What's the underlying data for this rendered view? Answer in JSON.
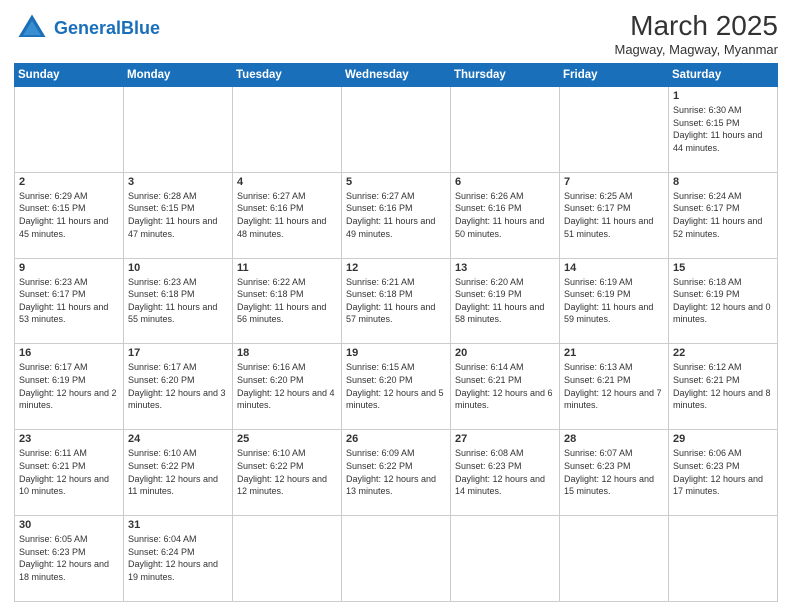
{
  "header": {
    "logo_general": "General",
    "logo_blue": "Blue",
    "month_title": "March 2025",
    "location": "Magway, Magway, Myanmar"
  },
  "weekdays": [
    "Sunday",
    "Monday",
    "Tuesday",
    "Wednesday",
    "Thursday",
    "Friday",
    "Saturday"
  ],
  "weeks": [
    [
      {
        "day": "",
        "info": ""
      },
      {
        "day": "",
        "info": ""
      },
      {
        "day": "",
        "info": ""
      },
      {
        "day": "",
        "info": ""
      },
      {
        "day": "",
        "info": ""
      },
      {
        "day": "",
        "info": ""
      },
      {
        "day": "1",
        "info": "Sunrise: 6:30 AM\nSunset: 6:15 PM\nDaylight: 11 hours and 44 minutes."
      }
    ],
    [
      {
        "day": "2",
        "info": "Sunrise: 6:29 AM\nSunset: 6:15 PM\nDaylight: 11 hours and 45 minutes."
      },
      {
        "day": "3",
        "info": "Sunrise: 6:28 AM\nSunset: 6:15 PM\nDaylight: 11 hours and 47 minutes."
      },
      {
        "day": "4",
        "info": "Sunrise: 6:27 AM\nSunset: 6:16 PM\nDaylight: 11 hours and 48 minutes."
      },
      {
        "day": "5",
        "info": "Sunrise: 6:27 AM\nSunset: 6:16 PM\nDaylight: 11 hours and 49 minutes."
      },
      {
        "day": "6",
        "info": "Sunrise: 6:26 AM\nSunset: 6:16 PM\nDaylight: 11 hours and 50 minutes."
      },
      {
        "day": "7",
        "info": "Sunrise: 6:25 AM\nSunset: 6:17 PM\nDaylight: 11 hours and 51 minutes."
      },
      {
        "day": "8",
        "info": "Sunrise: 6:24 AM\nSunset: 6:17 PM\nDaylight: 11 hours and 52 minutes."
      }
    ],
    [
      {
        "day": "9",
        "info": "Sunrise: 6:23 AM\nSunset: 6:17 PM\nDaylight: 11 hours and 53 minutes."
      },
      {
        "day": "10",
        "info": "Sunrise: 6:23 AM\nSunset: 6:18 PM\nDaylight: 11 hours and 55 minutes."
      },
      {
        "day": "11",
        "info": "Sunrise: 6:22 AM\nSunset: 6:18 PM\nDaylight: 11 hours and 56 minutes."
      },
      {
        "day": "12",
        "info": "Sunrise: 6:21 AM\nSunset: 6:18 PM\nDaylight: 11 hours and 57 minutes."
      },
      {
        "day": "13",
        "info": "Sunrise: 6:20 AM\nSunset: 6:19 PM\nDaylight: 11 hours and 58 minutes."
      },
      {
        "day": "14",
        "info": "Sunrise: 6:19 AM\nSunset: 6:19 PM\nDaylight: 11 hours and 59 minutes."
      },
      {
        "day": "15",
        "info": "Sunrise: 6:18 AM\nSunset: 6:19 PM\nDaylight: 12 hours and 0 minutes."
      }
    ],
    [
      {
        "day": "16",
        "info": "Sunrise: 6:17 AM\nSunset: 6:19 PM\nDaylight: 12 hours and 2 minutes."
      },
      {
        "day": "17",
        "info": "Sunrise: 6:17 AM\nSunset: 6:20 PM\nDaylight: 12 hours and 3 minutes."
      },
      {
        "day": "18",
        "info": "Sunrise: 6:16 AM\nSunset: 6:20 PM\nDaylight: 12 hours and 4 minutes."
      },
      {
        "day": "19",
        "info": "Sunrise: 6:15 AM\nSunset: 6:20 PM\nDaylight: 12 hours and 5 minutes."
      },
      {
        "day": "20",
        "info": "Sunrise: 6:14 AM\nSunset: 6:21 PM\nDaylight: 12 hours and 6 minutes."
      },
      {
        "day": "21",
        "info": "Sunrise: 6:13 AM\nSunset: 6:21 PM\nDaylight: 12 hours and 7 minutes."
      },
      {
        "day": "22",
        "info": "Sunrise: 6:12 AM\nSunset: 6:21 PM\nDaylight: 12 hours and 8 minutes."
      }
    ],
    [
      {
        "day": "23",
        "info": "Sunrise: 6:11 AM\nSunset: 6:21 PM\nDaylight: 12 hours and 10 minutes."
      },
      {
        "day": "24",
        "info": "Sunrise: 6:10 AM\nSunset: 6:22 PM\nDaylight: 12 hours and 11 minutes."
      },
      {
        "day": "25",
        "info": "Sunrise: 6:10 AM\nSunset: 6:22 PM\nDaylight: 12 hours and 12 minutes."
      },
      {
        "day": "26",
        "info": "Sunrise: 6:09 AM\nSunset: 6:22 PM\nDaylight: 12 hours and 13 minutes."
      },
      {
        "day": "27",
        "info": "Sunrise: 6:08 AM\nSunset: 6:23 PM\nDaylight: 12 hours and 14 minutes."
      },
      {
        "day": "28",
        "info": "Sunrise: 6:07 AM\nSunset: 6:23 PM\nDaylight: 12 hours and 15 minutes."
      },
      {
        "day": "29",
        "info": "Sunrise: 6:06 AM\nSunset: 6:23 PM\nDaylight: 12 hours and 17 minutes."
      }
    ],
    [
      {
        "day": "30",
        "info": "Sunrise: 6:05 AM\nSunset: 6:23 PM\nDaylight: 12 hours and 18 minutes."
      },
      {
        "day": "31",
        "info": "Sunrise: 6:04 AM\nSunset: 6:24 PM\nDaylight: 12 hours and 19 minutes."
      },
      {
        "day": "",
        "info": ""
      },
      {
        "day": "",
        "info": ""
      },
      {
        "day": "",
        "info": ""
      },
      {
        "day": "",
        "info": ""
      },
      {
        "day": "",
        "info": ""
      }
    ]
  ]
}
